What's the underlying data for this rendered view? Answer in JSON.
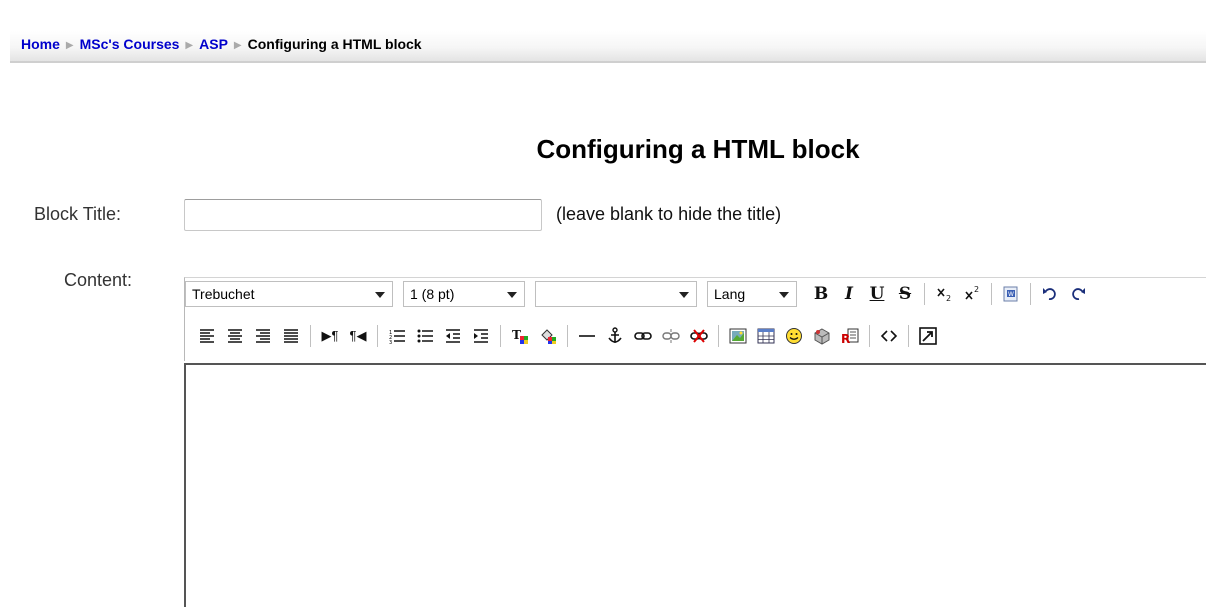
{
  "breadcrumb": {
    "items": [
      "Home",
      "MSc's Courses",
      "ASP"
    ],
    "current": "Configuring a HTML block"
  },
  "page": {
    "title": "Configuring a HTML block"
  },
  "form": {
    "block_title_label": "Block Title:",
    "block_title_value": "",
    "block_title_hint": "(leave blank to hide the title)",
    "content_label": "Content:"
  },
  "editor": {
    "font_family": "Trebuchet",
    "font_size": "1 (8 pt)",
    "heading": "",
    "lang": "Lang",
    "bold_label": "B",
    "italic_label": "I",
    "underline_label": "U",
    "strike_label": "S",
    "content": ""
  },
  "colors": {
    "link": "#0000cc",
    "navbar_gradient_end": "#e4e4e4"
  }
}
